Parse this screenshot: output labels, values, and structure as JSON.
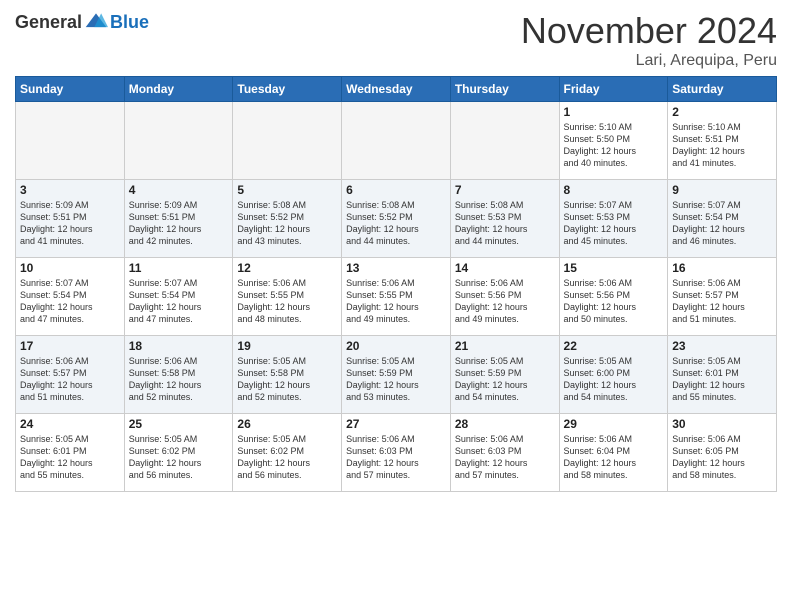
{
  "header": {
    "logo_general": "General",
    "logo_blue": "Blue",
    "month": "November 2024",
    "location": "Lari, Arequipa, Peru"
  },
  "weekdays": [
    "Sunday",
    "Monday",
    "Tuesday",
    "Wednesday",
    "Thursday",
    "Friday",
    "Saturday"
  ],
  "weeks": [
    [
      {
        "day": "",
        "info": ""
      },
      {
        "day": "",
        "info": ""
      },
      {
        "day": "",
        "info": ""
      },
      {
        "day": "",
        "info": ""
      },
      {
        "day": "",
        "info": ""
      },
      {
        "day": "1",
        "info": "Sunrise: 5:10 AM\nSunset: 5:50 PM\nDaylight: 12 hours\nand 40 minutes."
      },
      {
        "day": "2",
        "info": "Sunrise: 5:10 AM\nSunset: 5:51 PM\nDaylight: 12 hours\nand 41 minutes."
      }
    ],
    [
      {
        "day": "3",
        "info": "Sunrise: 5:09 AM\nSunset: 5:51 PM\nDaylight: 12 hours\nand 41 minutes."
      },
      {
        "day": "4",
        "info": "Sunrise: 5:09 AM\nSunset: 5:51 PM\nDaylight: 12 hours\nand 42 minutes."
      },
      {
        "day": "5",
        "info": "Sunrise: 5:08 AM\nSunset: 5:52 PM\nDaylight: 12 hours\nand 43 minutes."
      },
      {
        "day": "6",
        "info": "Sunrise: 5:08 AM\nSunset: 5:52 PM\nDaylight: 12 hours\nand 44 minutes."
      },
      {
        "day": "7",
        "info": "Sunrise: 5:08 AM\nSunset: 5:53 PM\nDaylight: 12 hours\nand 44 minutes."
      },
      {
        "day": "8",
        "info": "Sunrise: 5:07 AM\nSunset: 5:53 PM\nDaylight: 12 hours\nand 45 minutes."
      },
      {
        "day": "9",
        "info": "Sunrise: 5:07 AM\nSunset: 5:54 PM\nDaylight: 12 hours\nand 46 minutes."
      }
    ],
    [
      {
        "day": "10",
        "info": "Sunrise: 5:07 AM\nSunset: 5:54 PM\nDaylight: 12 hours\nand 47 minutes."
      },
      {
        "day": "11",
        "info": "Sunrise: 5:07 AM\nSunset: 5:54 PM\nDaylight: 12 hours\nand 47 minutes."
      },
      {
        "day": "12",
        "info": "Sunrise: 5:06 AM\nSunset: 5:55 PM\nDaylight: 12 hours\nand 48 minutes."
      },
      {
        "day": "13",
        "info": "Sunrise: 5:06 AM\nSunset: 5:55 PM\nDaylight: 12 hours\nand 49 minutes."
      },
      {
        "day": "14",
        "info": "Sunrise: 5:06 AM\nSunset: 5:56 PM\nDaylight: 12 hours\nand 49 minutes."
      },
      {
        "day": "15",
        "info": "Sunrise: 5:06 AM\nSunset: 5:56 PM\nDaylight: 12 hours\nand 50 minutes."
      },
      {
        "day": "16",
        "info": "Sunrise: 5:06 AM\nSunset: 5:57 PM\nDaylight: 12 hours\nand 51 minutes."
      }
    ],
    [
      {
        "day": "17",
        "info": "Sunrise: 5:06 AM\nSunset: 5:57 PM\nDaylight: 12 hours\nand 51 minutes."
      },
      {
        "day": "18",
        "info": "Sunrise: 5:06 AM\nSunset: 5:58 PM\nDaylight: 12 hours\nand 52 minutes."
      },
      {
        "day": "19",
        "info": "Sunrise: 5:05 AM\nSunset: 5:58 PM\nDaylight: 12 hours\nand 52 minutes."
      },
      {
        "day": "20",
        "info": "Sunrise: 5:05 AM\nSunset: 5:59 PM\nDaylight: 12 hours\nand 53 minutes."
      },
      {
        "day": "21",
        "info": "Sunrise: 5:05 AM\nSunset: 5:59 PM\nDaylight: 12 hours\nand 54 minutes."
      },
      {
        "day": "22",
        "info": "Sunrise: 5:05 AM\nSunset: 6:00 PM\nDaylight: 12 hours\nand 54 minutes."
      },
      {
        "day": "23",
        "info": "Sunrise: 5:05 AM\nSunset: 6:01 PM\nDaylight: 12 hours\nand 55 minutes."
      }
    ],
    [
      {
        "day": "24",
        "info": "Sunrise: 5:05 AM\nSunset: 6:01 PM\nDaylight: 12 hours\nand 55 minutes."
      },
      {
        "day": "25",
        "info": "Sunrise: 5:05 AM\nSunset: 6:02 PM\nDaylight: 12 hours\nand 56 minutes."
      },
      {
        "day": "26",
        "info": "Sunrise: 5:05 AM\nSunset: 6:02 PM\nDaylight: 12 hours\nand 56 minutes."
      },
      {
        "day": "27",
        "info": "Sunrise: 5:06 AM\nSunset: 6:03 PM\nDaylight: 12 hours\nand 57 minutes."
      },
      {
        "day": "28",
        "info": "Sunrise: 5:06 AM\nSunset: 6:03 PM\nDaylight: 12 hours\nand 57 minutes."
      },
      {
        "day": "29",
        "info": "Sunrise: 5:06 AM\nSunset: 6:04 PM\nDaylight: 12 hours\nand 58 minutes."
      },
      {
        "day": "30",
        "info": "Sunrise: 5:06 AM\nSunset: 6:05 PM\nDaylight: 12 hours\nand 58 minutes."
      }
    ]
  ]
}
